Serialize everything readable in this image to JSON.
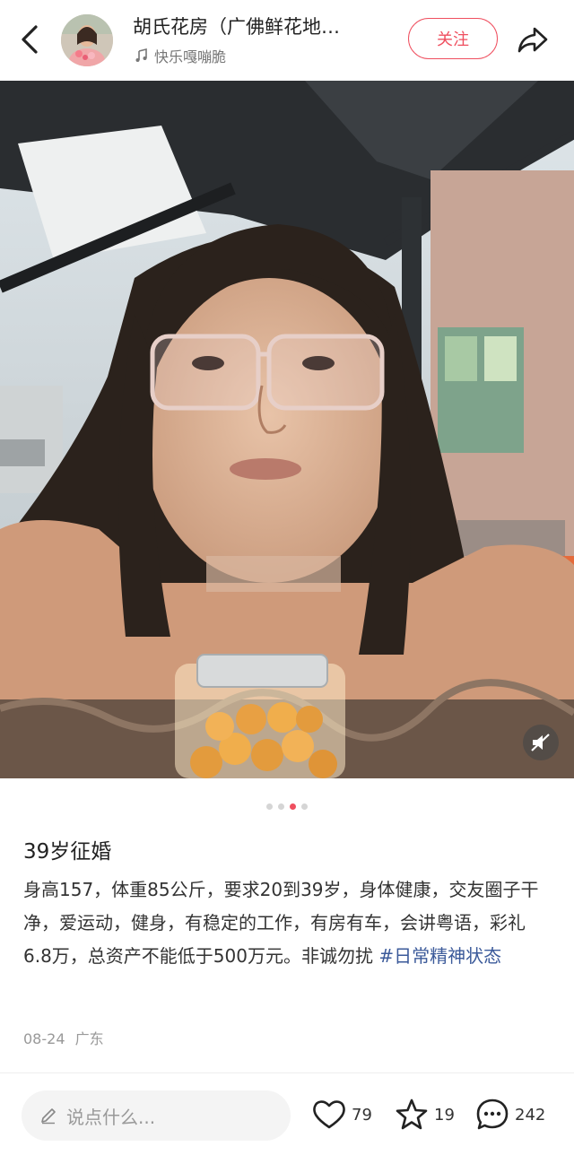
{
  "header": {
    "author_name": "胡氏花房（广佛鲜花地…",
    "music": "快乐嘎嘣脆",
    "follow_label": "关注"
  },
  "carousel": {
    "total": 4,
    "active": 3
  },
  "post": {
    "title": "39岁征婚",
    "body": "身高157，体重85公斤，要求20到39岁，身体健康，交友圈子干净，爱运动，健身，有稳定的工作，有房有车，会讲粤语，彩礼6.8万，总资产不能低于500万元。非诚勿扰 ",
    "hashtag": "#日常精神状态",
    "date": "08-24",
    "location": "广东"
  },
  "bottom_bar": {
    "comment_placeholder": "说点什么...",
    "likes": "79",
    "collects": "19",
    "comments": "242"
  },
  "colors": {
    "accent": "#ef4f5f",
    "hashtag": "#3b5a9a"
  }
}
